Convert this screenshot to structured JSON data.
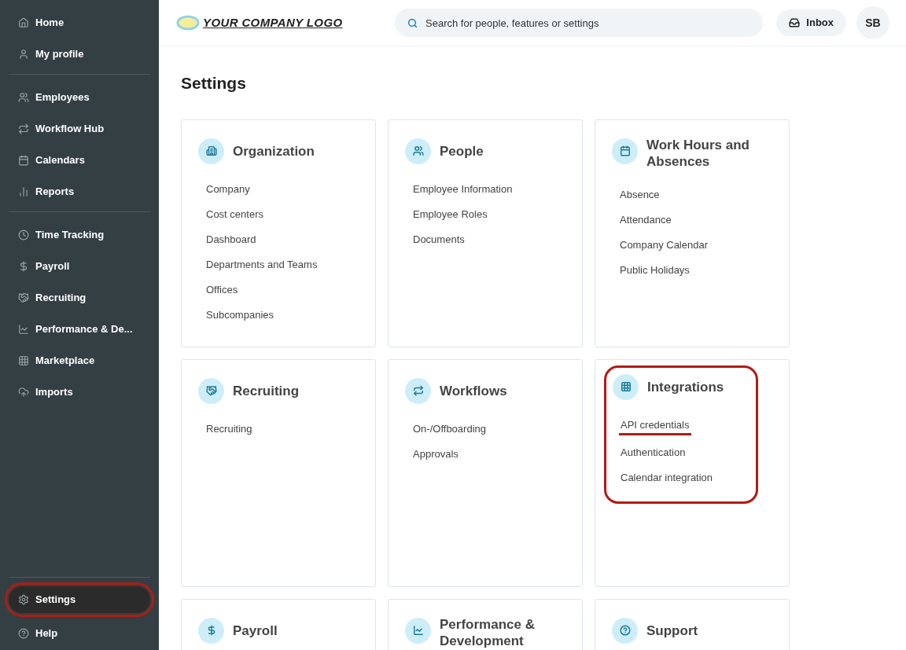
{
  "sidebar": {
    "groups": [
      [
        {
          "label": "Home",
          "selected": false,
          "annotated": false
        },
        {
          "label": "My profile",
          "selected": false,
          "annotated": false
        }
      ],
      [
        {
          "label": "Employees",
          "selected": false,
          "annotated": false
        },
        {
          "label": "Workflow Hub",
          "selected": false,
          "annotated": false
        },
        {
          "label": "Calendars",
          "selected": false,
          "annotated": false
        },
        {
          "label": "Reports",
          "selected": false,
          "annotated": false
        }
      ],
      [
        {
          "label": "Time Tracking",
          "selected": false,
          "annotated": false
        },
        {
          "label": "Payroll",
          "selected": false,
          "annotated": false
        },
        {
          "label": "Recruiting",
          "selected": false,
          "annotated": false
        },
        {
          "label": "Performance & De...",
          "selected": false,
          "annotated": false
        },
        {
          "label": "Marketplace",
          "selected": false,
          "annotated": false
        },
        {
          "label": "Imports",
          "selected": false,
          "annotated": false
        }
      ]
    ],
    "footer": [
      {
        "label": "Settings",
        "selected": true,
        "annotated": true
      },
      {
        "label": "Help",
        "selected": false,
        "annotated": false
      }
    ]
  },
  "header": {
    "logo": "YOUR COMPANY LOGO",
    "search": {
      "placeholder": "Search for people, features or settings"
    },
    "inbox": "Inbox",
    "avatar": "SB"
  },
  "page_title": "Settings",
  "cards": [
    {
      "title": "Organization",
      "annotated": false,
      "links": [
        {
          "label": "Company",
          "annotated": false
        },
        {
          "label": "Cost centers",
          "annotated": false
        },
        {
          "label": "Dashboard",
          "annotated": false
        },
        {
          "label": "Departments and Teams",
          "annotated": false
        },
        {
          "label": "Offices",
          "annotated": false
        },
        {
          "label": "Subcompanies",
          "annotated": false
        }
      ]
    },
    {
      "title": "People",
      "annotated": false,
      "links": [
        {
          "label": "Employee Information",
          "annotated": false
        },
        {
          "label": "Employee Roles",
          "annotated": false
        },
        {
          "label": "Documents",
          "annotated": false
        }
      ]
    },
    {
      "title": "Work Hours and Absences",
      "annotated": false,
      "links": [
        {
          "label": "Absence",
          "annotated": false
        },
        {
          "label": "Attendance",
          "annotated": false
        },
        {
          "label": "Company Calendar",
          "annotated": false
        },
        {
          "label": "Public Holidays",
          "annotated": false
        }
      ]
    },
    {
      "title": "Recruiting",
      "annotated": false,
      "links": [
        {
          "label": "Recruiting",
          "annotated": false
        }
      ]
    },
    {
      "title": "Workflows",
      "annotated": false,
      "links": [
        {
          "label": "On-/Offboarding",
          "annotated": false
        },
        {
          "label": "Approvals",
          "annotated": false
        }
      ]
    },
    {
      "title": "Integrations",
      "annotated": true,
      "links": [
        {
          "label": "API credentials",
          "annotated": true
        },
        {
          "label": "Authentication",
          "annotated": false
        },
        {
          "label": "Calendar integration",
          "annotated": false
        }
      ]
    },
    {
      "title": "Payroll",
      "annotated": false
    },
    {
      "title": "Performance & Development",
      "annotated": false
    },
    {
      "title": "Support",
      "annotated": false
    }
  ]
}
